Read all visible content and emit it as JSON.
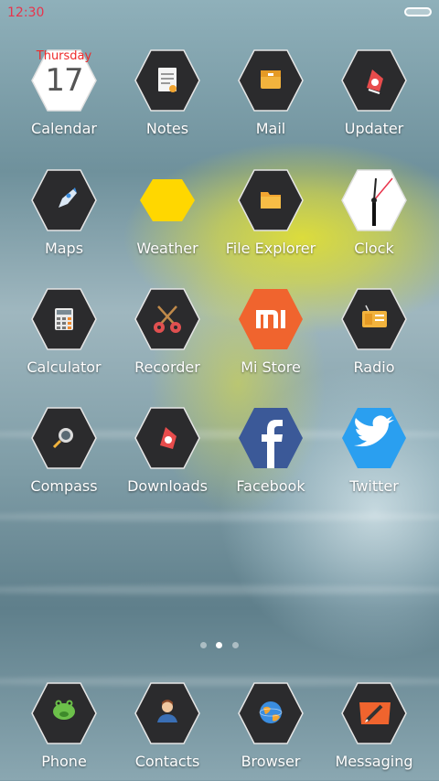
{
  "status_bar": {
    "time": "12:30"
  },
  "calendar": {
    "day_name": "Thursday",
    "date": "17"
  },
  "apps": [
    {
      "label": "Calendar",
      "icon": "calendar-icon"
    },
    {
      "label": "Notes",
      "icon": "notes-icon"
    },
    {
      "label": "Mail",
      "icon": "mail-icon"
    },
    {
      "label": "Updater",
      "icon": "updater-icon"
    },
    {
      "label": "Maps",
      "icon": "rocket-icon"
    },
    {
      "label": "Weather",
      "icon": "weather-icon"
    },
    {
      "label": "File Explorer",
      "icon": "folder-icon"
    },
    {
      "label": "Clock",
      "icon": "clock-icon"
    },
    {
      "label": "Calculator",
      "icon": "calculator-icon"
    },
    {
      "label": "Recorder",
      "icon": "guitars-icon"
    },
    {
      "label": "Mi Store",
      "icon": "mi-logo-icon"
    },
    {
      "label": "Radio",
      "icon": "radio-icon"
    },
    {
      "label": "Compass",
      "icon": "compass-icon"
    },
    {
      "label": "Downloads",
      "icon": "downloads-icon"
    },
    {
      "label": "Facebook",
      "icon": "facebook-icon"
    },
    {
      "label": "Twitter",
      "icon": "twitter-bird-icon"
    }
  ],
  "dock": [
    {
      "label": "Phone",
      "icon": "phone-frog-icon"
    },
    {
      "label": "Contacts",
      "icon": "contacts-person-icon"
    },
    {
      "label": "Browser",
      "icon": "globe-icon"
    },
    {
      "label": "Messaging",
      "icon": "messaging-pencil-icon"
    }
  ],
  "pager": {
    "pages": 3,
    "active": 1
  },
  "colors": {
    "hex_dark": "#2b2b2d",
    "hex_border": "#e6e6e6",
    "time_red": "#e8344c",
    "weather_yellow": "#ffd700",
    "mi_orange": "#f0642e",
    "facebook_blue": "#3b5998",
    "twitter_blue": "#2a9ff0"
  }
}
